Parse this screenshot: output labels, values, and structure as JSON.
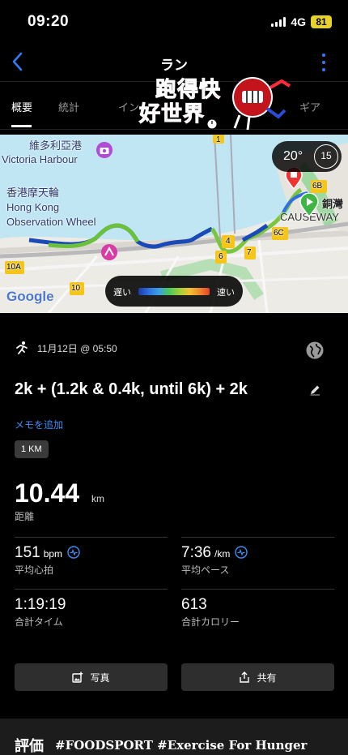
{
  "status": {
    "time": "09:20",
    "network": "4G",
    "battery": "81"
  },
  "nav": {
    "title": "ラン"
  },
  "tabs": [
    {
      "label": "概要",
      "active": true
    },
    {
      "label": "統計",
      "active": false
    },
    {
      "label": "イン",
      "active": false
    },
    {
      "label": "ギア",
      "active": false
    }
  ],
  "logo": {
    "line1": "跑得快",
    "line2": "好世界"
  },
  "map": {
    "labels": {
      "victoria_zh": "維多利亞港",
      "victoria_en": "Victoria Harbour",
      "wheel_zh": "香港摩天輪",
      "wheel_en1": "Hong Kong",
      "wheel_en2": "Observation Wheel",
      "causeway_zh": "銅灣",
      "causeway_en": "CAUSEWAY",
      "road_10a": "10A",
      "road_10": "10",
      "road_6c": "6C",
      "road_6b": "6B",
      "road_4": "4",
      "road_6": "6",
      "road_7": "7",
      "road_1": "1",
      "google": "Google"
    },
    "weather": {
      "temp": "20°",
      "wind": "15"
    },
    "pace_legend": {
      "slow": "遅い",
      "fast": "速い"
    }
  },
  "activity": {
    "date": "11月12日 @ 05:50",
    "title": "2k + (1.2k & 0.4k, until 6k) + 2k",
    "memo_link": "メモを追加",
    "lap_badge": "1 KM",
    "distance": {
      "value": "10.44",
      "unit": "km",
      "label": "距離"
    },
    "stats": [
      {
        "value": "151",
        "unit": "bpm",
        "label": "平均心拍"
      },
      {
        "value": "7:36",
        "unit": "/km",
        "label": "平均ペース"
      },
      {
        "value": "1:19:19",
        "unit": "",
        "label": "合計タイム"
      },
      {
        "value": "613",
        "unit": "",
        "label": "合計カロリー"
      }
    ]
  },
  "buttons": {
    "photo": "写真",
    "share": "共有"
  },
  "rating": {
    "label": "評価",
    "watermark": "#FOODSPORT #Exercise For Hunger"
  },
  "colors": {
    "accent": "#2f7cf6",
    "link": "#3d8df5",
    "battery": "#e8d22a",
    "logo_red": "#e0141b"
  },
  "icons": [
    "back-chevron-icon",
    "more-vertical-icon",
    "run-icon",
    "globe-icon",
    "pencil-icon",
    "info-pulse-icon",
    "add-photo-icon",
    "share-icon",
    "start-pin-icon",
    "end-pin-icon"
  ]
}
